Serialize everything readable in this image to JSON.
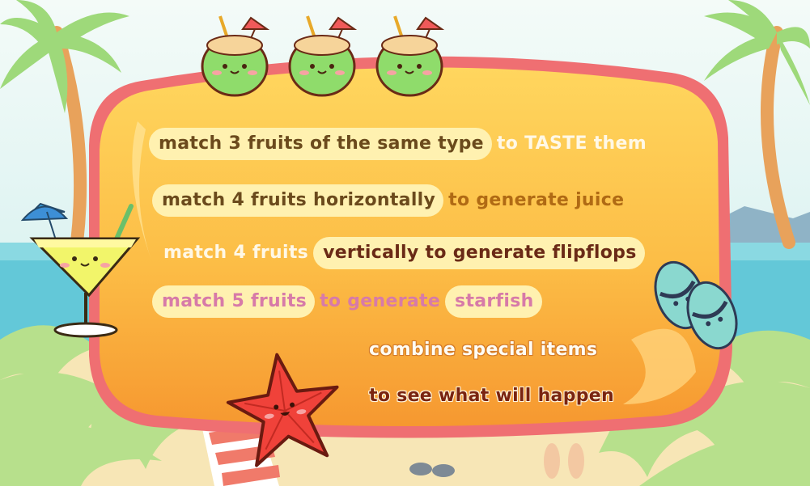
{
  "instructions": {
    "line1": {
      "pill": "match 3 fruits of the same type",
      "rest": "to TASTE them"
    },
    "line2": {
      "pill": "match 4 fruits horizontally",
      "rest": "to generate juice"
    },
    "line3": {
      "plain": "match 4 fruits",
      "pill": "vertically to generate flipflops"
    },
    "line4": {
      "pill1": "match 5 fruits",
      "plain": "to generate",
      "pill2": "starfish"
    },
    "line5": "combine special items",
    "line6": "to see what will happen"
  },
  "decorations": {
    "top": [
      "coconut-drink",
      "coconut-drink",
      "coconut-drink"
    ],
    "left": "cocktail-glass",
    "right": "flipflops",
    "bottom": "starfish"
  },
  "colors": {
    "panel_border": "#ef6f72",
    "panel_fill_top": "#ffd45b",
    "panel_fill_bottom": "#f9a034",
    "pill": "#fff1b0"
  }
}
